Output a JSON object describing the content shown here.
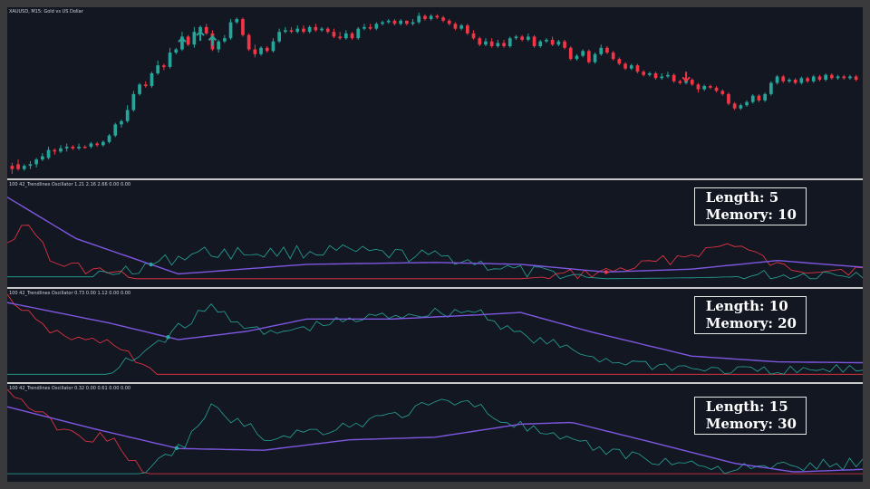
{
  "main": {
    "symbol_label": "XAUUSD, M15:  Gold vs US Dollar",
    "colors": {
      "background": "#131722",
      "bull": "#26a69a",
      "bear": "#f23645",
      "ma": "#7e57e0",
      "text": "#cfd3dc"
    },
    "candles": [
      [
        96,
        98,
        101,
        94
      ],
      [
        95,
        98,
        99,
        92
      ],
      [
        98,
        96,
        99,
        95
      ],
      [
        96,
        95,
        98,
        93
      ],
      [
        95,
        92,
        97,
        91
      ],
      [
        92,
        90,
        93,
        88
      ],
      [
        91,
        86,
        92,
        84
      ],
      [
        86,
        87,
        89,
        85
      ],
      [
        87,
        85,
        88,
        83
      ],
      [
        85,
        84,
        87,
        82
      ],
      [
        84,
        85,
        86,
        83
      ],
      [
        85,
        84,
        86,
        82
      ],
      [
        84,
        84,
        85,
        83
      ],
      [
        84,
        82,
        85,
        81
      ],
      [
        82,
        83,
        84,
        81
      ],
      [
        83,
        81,
        84,
        80
      ],
      [
        81,
        77,
        82,
        76
      ],
      [
        77,
        70,
        78,
        69
      ],
      [
        70,
        68,
        72,
        67
      ],
      [
        68,
        61,
        69,
        58
      ],
      [
        61,
        51,
        62,
        49
      ],
      [
        51,
        45,
        52,
        44
      ],
      [
        45,
        46,
        47,
        43
      ],
      [
        46,
        38,
        47,
        37
      ],
      [
        38,
        33,
        39,
        30
      ],
      [
        33,
        34,
        36,
        32
      ],
      [
        34,
        25,
        35,
        22
      ],
      [
        25,
        23,
        26,
        22
      ],
      [
        23,
        15,
        24,
        12
      ],
      [
        15,
        20,
        21,
        14
      ],
      [
        20,
        12,
        22,
        9
      ],
      [
        12,
        9,
        13,
        8
      ],
      [
        9,
        13,
        14,
        7
      ],
      [
        13,
        23,
        24,
        11
      ],
      [
        23,
        18,
        25,
        17
      ],
      [
        18,
        16,
        19,
        14
      ],
      [
        16,
        6,
        17,
        4
      ],
      [
        6,
        4,
        7,
        3
      ],
      [
        4,
        14,
        15,
        3
      ],
      [
        14,
        23,
        24,
        13
      ],
      [
        23,
        26,
        28,
        20
      ],
      [
        26,
        22,
        27,
        21
      ],
      [
        22,
        24,
        25,
        21
      ],
      [
        24,
        18,
        25,
        16
      ],
      [
        18,
        12,
        19,
        10
      ],
      [
        12,
        11,
        13,
        9
      ],
      [
        11,
        12,
        13,
        9
      ],
      [
        12,
        10,
        13,
        8
      ],
      [
        10,
        12,
        13,
        8
      ],
      [
        12,
        9,
        13,
        8
      ],
      [
        9,
        11,
        12,
        7
      ],
      [
        11,
        10,
        12,
        9
      ],
      [
        10,
        12,
        13,
        9
      ],
      [
        12,
        15,
        16,
        10
      ],
      [
        15,
        16,
        17,
        12
      ],
      [
        16,
        13,
        17,
        11
      ],
      [
        13,
        16,
        17,
        12
      ],
      [
        16,
        10,
        17,
        9
      ],
      [
        10,
        9,
        11,
        7
      ],
      [
        9,
        10,
        11,
        7
      ],
      [
        10,
        7,
        11,
        6
      ],
      [
        7,
        6,
        8,
        5
      ],
      [
        6,
        5,
        7,
        4
      ],
      [
        5,
        7,
        8,
        4
      ],
      [
        7,
        5,
        8,
        4
      ],
      [
        5,
        7,
        8,
        5
      ],
      [
        7,
        6,
        8,
        4
      ],
      [
        6,
        2,
        7,
        0
      ],
      [
        2,
        4,
        5,
        1
      ],
      [
        4,
        2,
        5,
        1
      ],
      [
        2,
        3,
        4,
        1
      ],
      [
        3,
        5,
        6,
        2
      ],
      [
        5,
        7,
        8,
        4
      ],
      [
        7,
        10,
        11,
        6
      ],
      [
        10,
        8,
        11,
        7
      ],
      [
        8,
        13,
        14,
        7
      ],
      [
        13,
        16,
        17,
        11
      ],
      [
        16,
        20,
        21,
        15
      ],
      [
        20,
        18,
        21,
        16
      ],
      [
        18,
        21,
        22,
        16
      ],
      [
        21,
        19,
        22,
        17
      ],
      [
        19,
        21,
        22,
        17
      ],
      [
        21,
        16,
        22,
        15
      ],
      [
        16,
        15,
        17,
        14
      ],
      [
        15,
        17,
        18,
        14
      ],
      [
        17,
        15,
        18,
        13
      ],
      [
        15,
        21,
        22,
        14
      ],
      [
        21,
        18,
        22,
        17
      ],
      [
        18,
        17,
        19,
        16
      ],
      [
        17,
        20,
        21,
        15
      ],
      [
        20,
        18,
        21,
        17
      ],
      [
        18,
        22,
        23,
        17
      ],
      [
        22,
        29,
        30,
        21
      ],
      [
        29,
        27,
        30,
        26
      ],
      [
        27,
        24,
        28,
        23
      ],
      [
        24,
        31,
        32,
        23
      ],
      [
        31,
        26,
        32,
        25
      ],
      [
        26,
        22,
        27,
        20
      ],
      [
        22,
        25,
        26,
        21
      ],
      [
        25,
        29,
        30,
        24
      ],
      [
        29,
        32,
        33,
        28
      ],
      [
        32,
        35,
        36,
        31
      ],
      [
        35,
        33,
        36,
        32
      ],
      [
        33,
        37,
        38,
        32
      ],
      [
        37,
        39,
        40,
        36
      ],
      [
        39,
        38,
        40,
        37
      ],
      [
        38,
        41,
        42,
        37
      ],
      [
        41,
        40,
        42,
        38
      ],
      [
        40,
        39,
        41,
        37
      ],
      [
        39,
        43,
        44,
        38
      ],
      [
        43,
        44,
        45,
        42
      ],
      [
        44,
        42,
        45,
        41
      ],
      [
        42,
        45,
        46,
        41
      ],
      [
        45,
        48,
        50,
        44
      ],
      [
        48,
        46,
        49,
        45
      ],
      [
        46,
        47,
        48,
        45
      ],
      [
        47,
        49,
        50,
        46
      ],
      [
        49,
        51,
        52,
        48
      ],
      [
        51,
        57,
        58,
        50
      ],
      [
        57,
        60,
        61,
        56
      ],
      [
        60,
        58,
        61,
        57
      ],
      [
        58,
        56,
        59,
        55
      ],
      [
        56,
        52,
        57,
        51
      ],
      [
        52,
        55,
        56,
        51
      ],
      [
        55,
        51,
        56,
        50
      ],
      [
        51,
        44,
        52,
        43
      ],
      [
        44,
        40,
        45,
        39
      ],
      [
        40,
        43,
        44,
        39
      ],
      [
        43,
        42,
        44,
        41
      ],
      [
        42,
        44,
        45,
        41
      ],
      [
        44,
        41,
        45,
        40
      ],
      [
        41,
        43,
        44,
        40
      ],
      [
        43,
        40,
        44,
        39
      ],
      [
        40,
        42,
        43,
        39
      ],
      [
        42,
        39,
        43,
        38
      ],
      [
        39,
        41,
        42,
        38
      ],
      [
        41,
        40,
        42,
        39
      ],
      [
        40,
        41,
        42,
        39
      ],
      [
        41,
        40,
        42,
        39
      ],
      [
        40,
        42,
        43,
        39
      ]
    ],
    "ma_period": 12,
    "up_arrows": [
      28,
      31,
      33
    ],
    "down_arrow": 111
  },
  "panes": [
    {
      "header": "100 42_Trendlines Oscillator 1.21 2.16 2.66 0.00 0.00",
      "info_line1": "Length: 5",
      "info_line2": "Memory: 10",
      "dots": [
        {
          "color": "#26a69a",
          "t": 0.168
        },
        {
          "color": "#f23645",
          "t": 0.7
        }
      ]
    },
    {
      "header": "100 42_Trendlines Oscillator 0.73 0.00 1.12 0.00 0.00",
      "info_line1": "Length: 10",
      "info_line2": "Memory: 20",
      "dots": [
        {
          "color": "#26a69a",
          "t": 0.188
        }
      ]
    },
    {
      "header": "100 42_Trendlines Oscillator 0.32 0.00 0.61 0.00 0.00",
      "info_line1": "Length: 15",
      "info_line2": "Memory: 30",
      "dots": [
        {
          "color": "#26a69a",
          "t": 0.198
        }
      ]
    }
  ]
}
